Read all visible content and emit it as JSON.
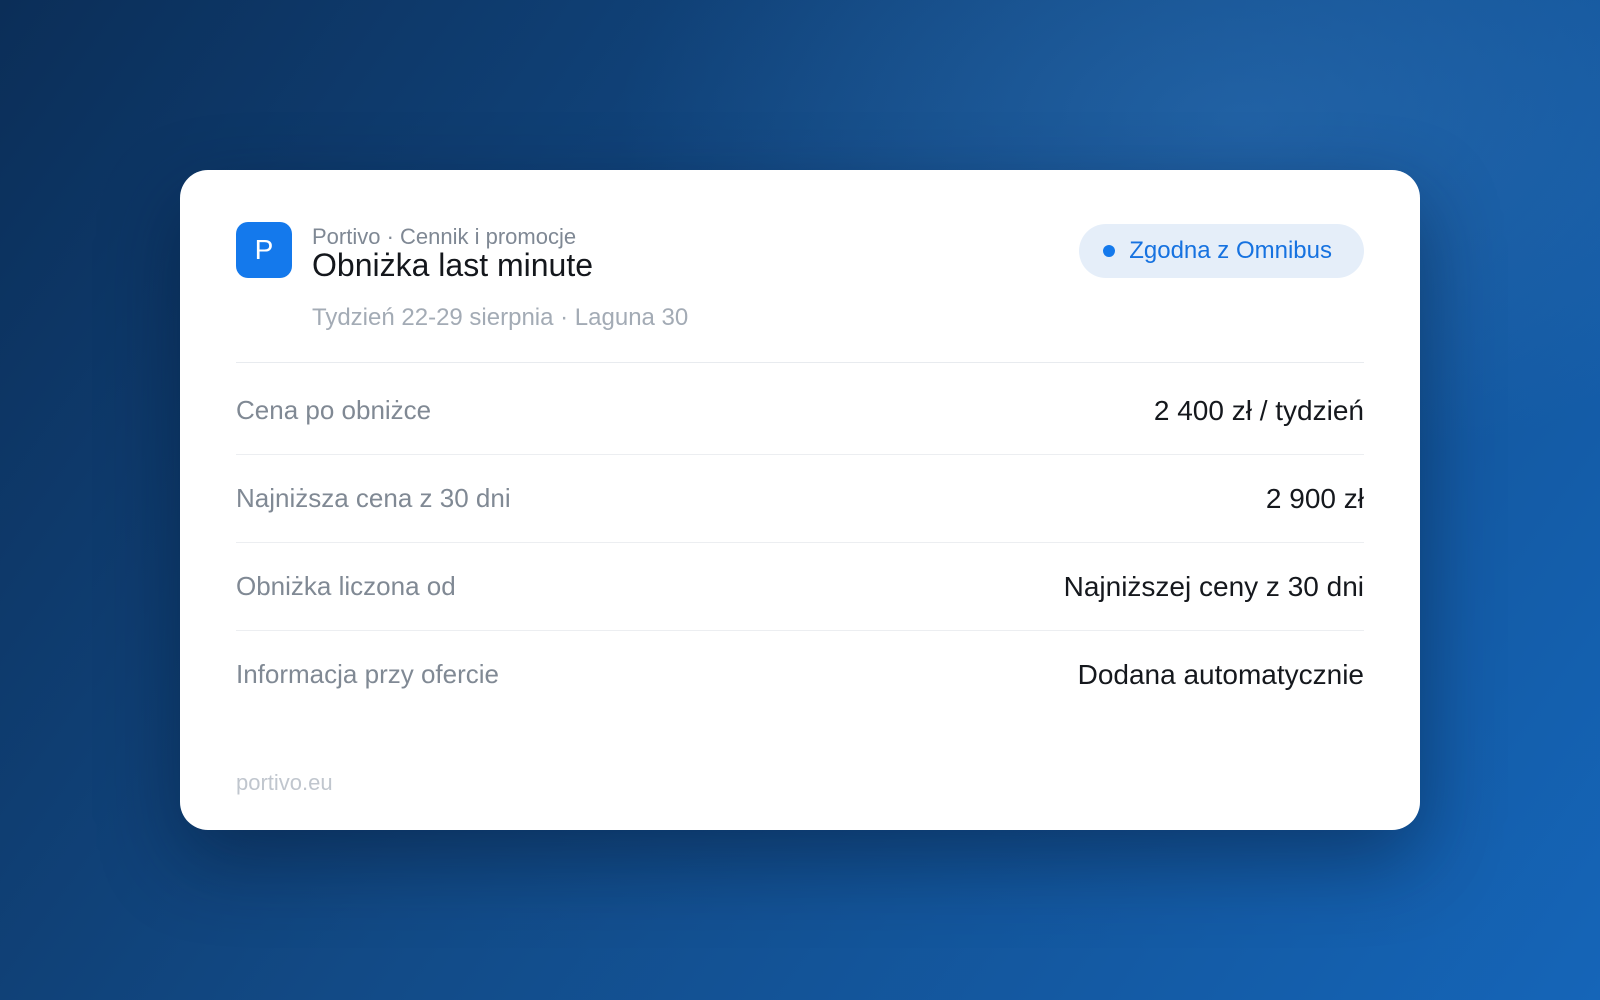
{
  "card": {
    "app_icon_letter": "P",
    "breadcrumb": "Portivo · Cennik i promocje",
    "title": "Obniżka last minute",
    "subtitle": "Tydzień 22-29 sierpnia · Laguna 30",
    "badge": {
      "label": "Zgodna z Omnibus",
      "color": "#1479ec"
    },
    "rows": [
      {
        "label": "Cena po obniżce",
        "value": "2 400 zł / tydzień"
      },
      {
        "label": "Najniższa cena z 30 dni",
        "value": "2 900 zł"
      },
      {
        "label": "Obniżka liczona od",
        "value": "Najniższej ceny z 30 dni"
      },
      {
        "label": "Informacja przy ofercie",
        "value": "Dodana automatycznie"
      }
    ],
    "footer": "portivo.eu"
  }
}
